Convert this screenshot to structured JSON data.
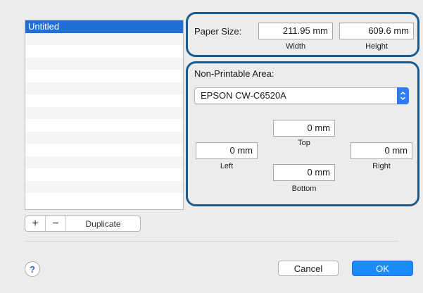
{
  "list": {
    "items": [
      "Untitled",
      "",
      "",
      "",
      "",
      "",
      "",
      "",
      "",
      "",
      "",
      "",
      "",
      "",
      ""
    ],
    "selected_index": 0
  },
  "list_buttons": {
    "add": "+",
    "remove": "−",
    "duplicate": "Duplicate"
  },
  "paper_size": {
    "label": "Paper Size:",
    "width_value": "211.95 mm",
    "width_label": "Width",
    "height_value": "609.6 mm",
    "height_label": "Height"
  },
  "non_printable": {
    "label": "Non-Printable Area:",
    "printer": "EPSON CW-C6520A",
    "top_value": "0 mm",
    "top_label": "Top",
    "left_value": "0 mm",
    "left_label": "Left",
    "right_value": "0 mm",
    "right_label": "Right",
    "bottom_value": "0 mm",
    "bottom_label": "Bottom"
  },
  "footer": {
    "help": "?",
    "cancel": "Cancel",
    "ok": "OK"
  },
  "colors": {
    "highlight_border": "#1c5a8c",
    "selection": "#1f6fd6",
    "ok_button": "#1b8afa"
  }
}
